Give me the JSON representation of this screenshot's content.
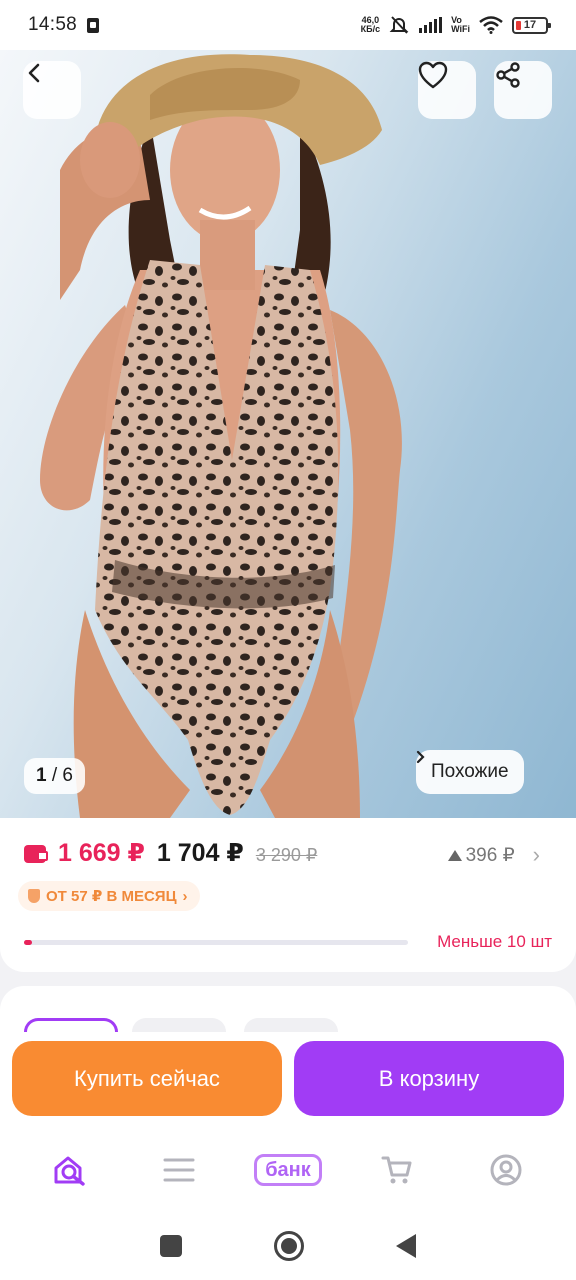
{
  "status_bar": {
    "time": "14:58",
    "speed_value": "46,0",
    "speed_unit": "КБ/с",
    "network": "Vo WiFi",
    "network_top": "Vo",
    "network_bottom": "WiFi",
    "battery": "17"
  },
  "gallery": {
    "counter_current": "1",
    "counter_total": "/ 6",
    "similar_label": "Похожие",
    "back_icon": "back-arrow-icon",
    "favorite_icon": "heart-icon",
    "share_icon": "share-icon"
  },
  "price": {
    "wallet_icon": "wallet-icon",
    "card_price": "1 669 ₽",
    "regular_price": "1 704 ₽",
    "old_price": "3 290 ₽",
    "price_change": "396 ₽",
    "installment": "ОТ 57 ₽ В МЕСЯЦ",
    "stock_label": "Меньше 10 шт",
    "stock_fraction": 0.02
  },
  "actions": {
    "buy_now": "Купить сейчас",
    "add_to_cart": "В корзину"
  },
  "bottom_nav": {
    "bank_label": "банк"
  },
  "colors": {
    "accent_purple": "#a13cf5",
    "accent_orange": "#f98b32",
    "price_red": "#e8235a"
  }
}
